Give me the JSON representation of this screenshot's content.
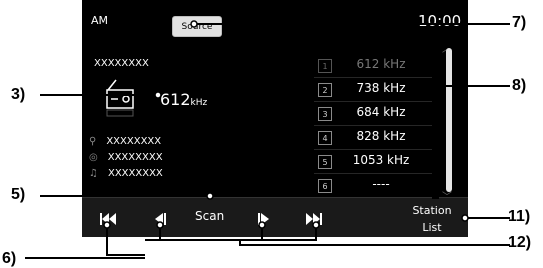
{
  "header": {
    "band": "AM",
    "source_label": "Source",
    "clock": "10:00"
  },
  "now_playing": {
    "station_name": "XXXXXXXX",
    "frequency": "612",
    "unit": "kHz",
    "artist": "XXXXXXXX",
    "album": "XXXXXXXX",
    "song": "XXXXXXXX"
  },
  "presets": [
    {
      "num": "1",
      "freq": "612 kHz"
    },
    {
      "num": "2",
      "freq": "738 kHz"
    },
    {
      "num": "3",
      "freq": "684 kHz"
    },
    {
      "num": "4",
      "freq": "828 kHz"
    },
    {
      "num": "5",
      "freq": "1053 kHz"
    },
    {
      "num": "6",
      "freq": "----"
    }
  ],
  "controls": {
    "scan_label": "Scan",
    "station_list_line1": "Station",
    "station_list_line2": "List"
  },
  "callouts": {
    "c3": "3)",
    "c5": "5)",
    "c6": "6)",
    "c7": "7)",
    "c8": "8)",
    "c11": "11)",
    "c12": "12)"
  }
}
